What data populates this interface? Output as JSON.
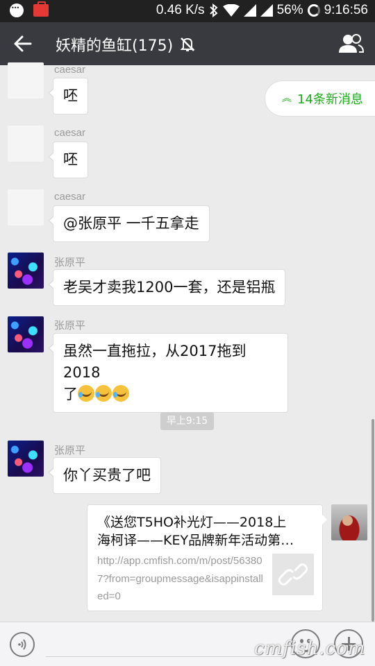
{
  "status_bar": {
    "speed": "0.46 K/s",
    "battery_pct": "56%",
    "time": "9:16:56"
  },
  "header": {
    "title": "妖精的鱼缸(175)",
    "back_icon": "arrow-left-icon",
    "mute_icon": "bell-off-icon",
    "members_icon": "group-members-icon",
    "bg_color": "#393a3f"
  },
  "new_messages": {
    "label": "14条新消息",
    "icon": "double-chevron-up-icon",
    "color": "#1aad19"
  },
  "messages": [
    {
      "sender": "caesar",
      "text": "呸"
    },
    {
      "sender": "caesar",
      "text": "呸"
    },
    {
      "sender": "caesar",
      "text": "@张原平 一千五拿走"
    },
    {
      "sender": "张原平",
      "text": "老吴才卖我1200一套，还是铝瓶"
    },
    {
      "sender": "张原平",
      "text_line1": "虽然一直拖拉，从2017拖到2018",
      "text_line2": "了"
    },
    {
      "sender": "张原平",
      "text": "你丫买贵了吧"
    }
  ],
  "timestamp": "早上9:15",
  "link_card": {
    "title_line1": "《送您T5HO补光灯——2018上",
    "title_line2": "海柯译——KEY品牌新年活动第…",
    "url": "http://app.cmfish.com/m/post/563807?from=groupmessage&isappinstalled=0",
    "thumb_icon": "link-icon"
  },
  "input_bar": {
    "voice_icon": "voice-icon",
    "emoji_icon": "smiley-icon",
    "plus_icon": "plus-icon"
  },
  "watermark": "cmfish.com"
}
